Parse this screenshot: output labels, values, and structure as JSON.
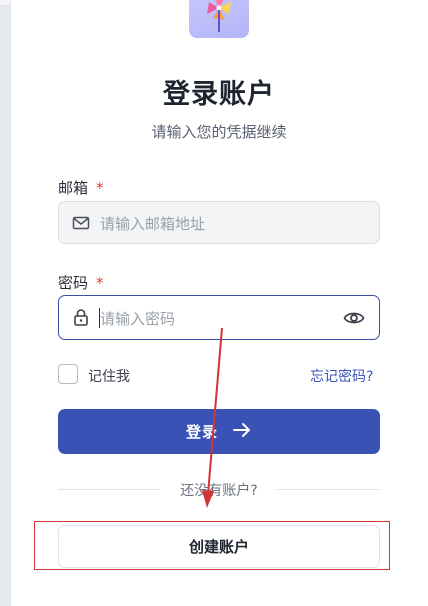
{
  "form": {
    "title": "登录账户",
    "subtitle": "请输入您的凭据继续",
    "email_label": "邮箱",
    "email_required": "*",
    "email_placeholder": "请输入邮箱地址",
    "password_label": "密码",
    "password_required": "*",
    "password_placeholder": "请输入密码",
    "remember_label": "记住我",
    "remember_checked": false,
    "forgot_link": "忘记密码?",
    "login_button": "登录",
    "divider_text": "还没有账户?",
    "create_button": "创建账户"
  },
  "colors": {
    "primary": "#3a52b6",
    "link": "#3a55b8",
    "required": "#e53935",
    "annotation": "#d23434"
  },
  "icons": {
    "email": "mail-icon",
    "password": "lock-icon",
    "toggle": "eye-icon",
    "login": "arrow-right-icon",
    "logo": "pinwheel-logo"
  }
}
